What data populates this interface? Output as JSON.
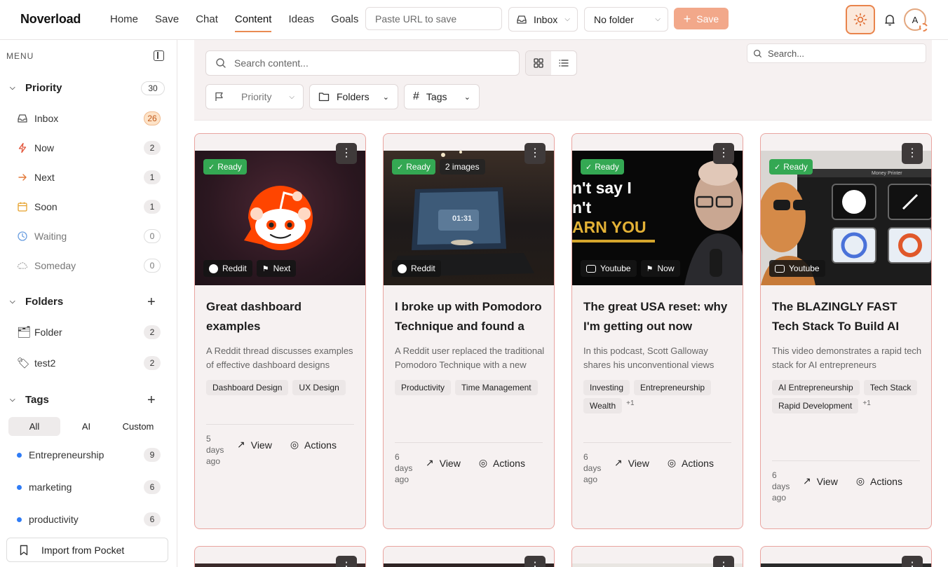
{
  "brand": "Noverload",
  "nav": [
    "Home",
    "Save",
    "Chat",
    "Content",
    "Ideas",
    "Goals"
  ],
  "nav_active": "Content",
  "url_input": {
    "placeholder": "Paste URL to save"
  },
  "inbox_select": "Inbox",
  "folder_select": "No folder",
  "save_label": "Save",
  "avatar_initial": "A",
  "sidebar": {
    "menu_label": "MENU",
    "priority": {
      "label": "Priority",
      "count": "30",
      "items": [
        {
          "label": "Inbox",
          "count": "26",
          "icon": "inbox-icon"
        },
        {
          "label": "Now",
          "count": "2",
          "icon": "bolt-icon"
        },
        {
          "label": "Next",
          "count": "1",
          "icon": "arrow-right-icon"
        },
        {
          "label": "Soon",
          "count": "1",
          "icon": "calendar-icon"
        },
        {
          "label": "Waiting",
          "count": "0",
          "icon": "clock-icon"
        },
        {
          "label": "Someday",
          "count": "0",
          "icon": "cloud-icon"
        }
      ]
    },
    "folders": {
      "label": "Folders",
      "items": [
        {
          "label": "Folder",
          "count": "2"
        },
        {
          "label": "test2",
          "count": "2"
        }
      ]
    },
    "tags": {
      "label": "Tags",
      "tabs": [
        "All",
        "AI",
        "Custom"
      ],
      "items": [
        {
          "label": "Entrepreneurship",
          "count": "9"
        },
        {
          "label": "marketing",
          "count": "6"
        },
        {
          "label": "productivity",
          "count": "6"
        }
      ]
    },
    "import_label": "Import from Pocket"
  },
  "filters": {
    "search_placeholder": "Search content...",
    "priority": "Priority",
    "folders": "Folders",
    "tags": "Tags",
    "right_search_placeholder": "Search..."
  },
  "cards": [
    {
      "status": "Ready",
      "source": "Reddit",
      "priority": "Next",
      "title": "Great dashboard examples",
      "desc": "A Reddit thread discusses examples of effective dashboard designs",
      "tags": [
        "Dashboard Design",
        "UX Design"
      ],
      "ago": "5 days ago",
      "view": "View",
      "actions": "Actions"
    },
    {
      "status": "Ready",
      "extra": "2 images",
      "source": "Reddit",
      "title": "I broke up with Pomodoro Technique and found a better way",
      "desc": "A Reddit user replaced the traditional Pomodoro Technique with a new system",
      "tags": [
        "Productivity",
        "Time Management"
      ],
      "ago": "6 days ago",
      "view": "View",
      "actions": "Actions",
      "screen_time": "01:31"
    },
    {
      "status": "Ready",
      "source": "Youtube",
      "priority": "Now",
      "title": "The great USA reset: why I'm getting out now",
      "desc": "In this podcast, Scott Galloway shares his unconventional views",
      "tags": [
        "Investing",
        "Entrepreneurship",
        "Wealth"
      ],
      "more": "+1",
      "ago": "6 days ago",
      "view": "View",
      "actions": "Actions",
      "thumb_text": [
        "n't say I",
        "n't",
        "ARN YOU"
      ]
    },
    {
      "status": "Ready",
      "source": "Youtube",
      "title": "The BLAZINGLY FAST Tech Stack To Build AI Apps",
      "desc": "This video demonstrates a rapid tech stack for AI entrepreneurs",
      "tags": [
        "AI Entrepreneurship",
        "Tech Stack",
        "Rapid Development"
      ],
      "more": "+1",
      "ago": "6 days ago",
      "view": "View",
      "actions": "Actions",
      "thumb_text": [
        "Money Printer"
      ]
    }
  ]
}
